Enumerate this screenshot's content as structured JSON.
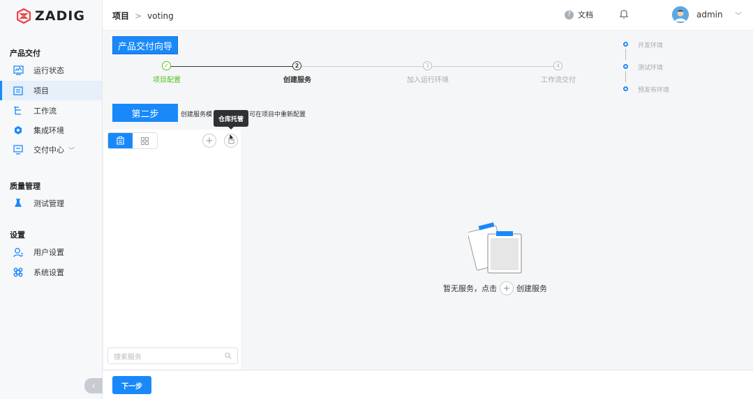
{
  "brand": {
    "name": "ZADIG",
    "color": "#e8474e"
  },
  "sidebar": {
    "sections": [
      {
        "title": "产品交付",
        "items": [
          {
            "label": "运行状态",
            "icon": "monitor-chart-icon"
          },
          {
            "label": "项目",
            "icon": "project-list-icon",
            "active": true
          },
          {
            "label": "工作流",
            "icon": "workflow-icon"
          },
          {
            "label": "集成环境",
            "icon": "snowflake-env-icon"
          },
          {
            "label": "交付中心",
            "icon": "delivery-screen-icon",
            "expandable": true
          }
        ]
      },
      {
        "title": "质量管理",
        "items": [
          {
            "label": "测试管理",
            "icon": "flask-icon"
          }
        ]
      },
      {
        "title": "设置",
        "items": [
          {
            "label": "用户设置",
            "icon": "user-settings-icon"
          },
          {
            "label": "系统设置",
            "icon": "command-icon"
          }
        ]
      }
    ],
    "collapse_label": "‹"
  },
  "header": {
    "breadcrumb": [
      "项目",
      "voting"
    ],
    "breadcrumb_sep": ">",
    "docs_label": "文档",
    "username": "admin"
  },
  "wizard": {
    "title": "产品交付向导",
    "steps": [
      {
        "num": "✓",
        "label": "项目配置",
        "state": "done"
      },
      {
        "num": "2",
        "label": "创建服务",
        "state": "current"
      },
      {
        "num": "3",
        "label": "加入运行环境",
        "state": "todo"
      },
      {
        "num": "4",
        "label": "工作流交付",
        "state": "todo"
      }
    ],
    "environments": [
      "开发环境",
      "测试环境",
      "预发布环境"
    ],
    "step_badge": "第二步",
    "step_desc_left": "创建服务模",
    "step_desc_right": "可在项目中重新配置",
    "tooltip": "仓库托管"
  },
  "panel": {
    "search_placeholder": "搜索服务",
    "add_label": "+"
  },
  "empty": {
    "text_before": "暂无服务，点击",
    "text_after": "创建服务",
    "plus": "+"
  },
  "footer": {
    "next_label": "下一步"
  },
  "colors": {
    "accent": "#1989fa",
    "success": "#52c41a"
  }
}
